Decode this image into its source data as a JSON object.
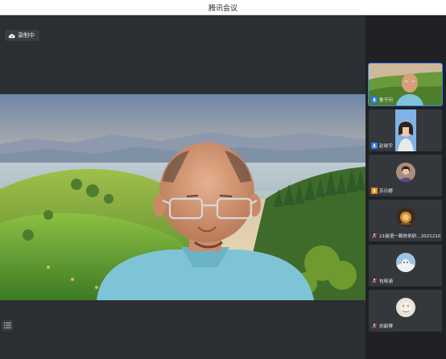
{
  "window": {
    "title": "腾讯会议"
  },
  "recording": {
    "label": "录制中"
  },
  "main_video": {
    "speaker_icon": "user-video"
  },
  "participants": [
    {
      "name": "鲁子问",
      "mic": "blue",
      "active": true,
      "type": "video"
    },
    {
      "name": "赵晓宇",
      "mic": "blue",
      "active": false,
      "type": "video"
    },
    {
      "name": "苏日娜",
      "mic": "orange",
      "active": false,
      "type": "avatar"
    },
    {
      "name": "21级语一赖依依研...20212100...",
      "mic": "none",
      "active": false,
      "type": "avatar"
    },
    {
      "name": "包晓涵",
      "mic": "none",
      "active": false,
      "type": "avatar"
    },
    {
      "name": "刘甜博",
      "mic": "none",
      "active": false,
      "type": "avatar"
    }
  ],
  "colors": {
    "accent": "#2b79e6",
    "stage": "#2b2e32",
    "sidebar": "#1f2124"
  }
}
